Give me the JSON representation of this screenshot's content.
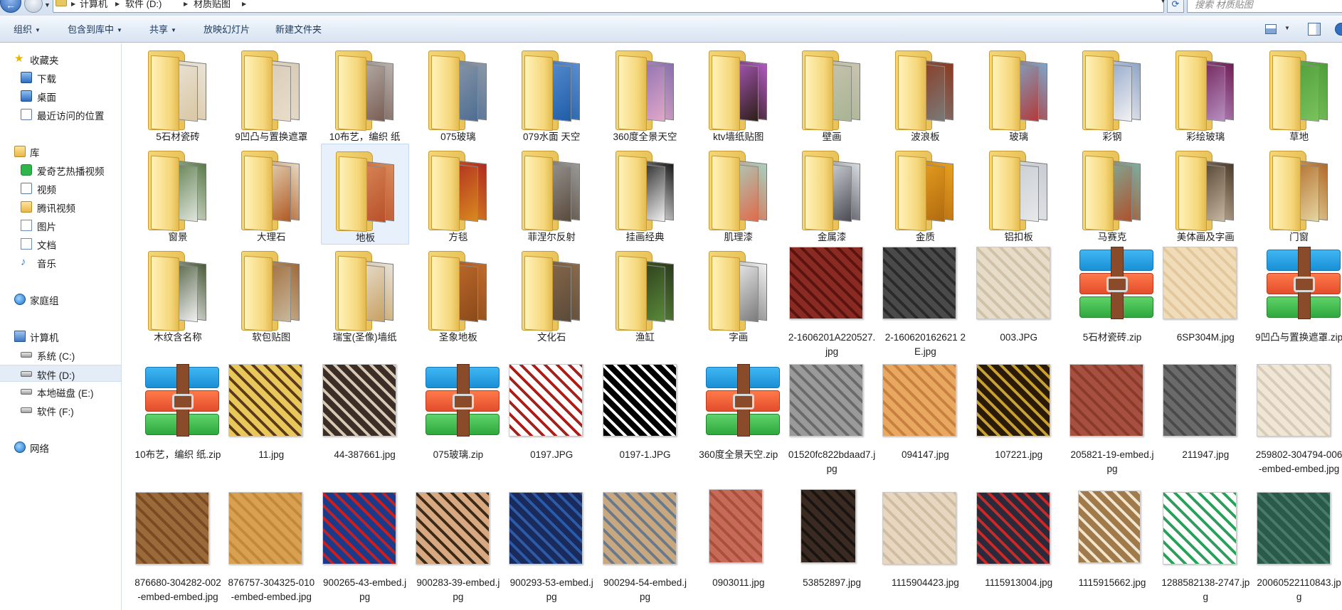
{
  "address_bar": {
    "breadcrumbs": [
      "计算机",
      "软件 (D:)",
      "材质贴图"
    ],
    "search_placeholder": "搜索 材质贴图"
  },
  "toolbar": {
    "organize": "组织",
    "include_in_library": "包含到库中",
    "share": "共享",
    "slideshow": "放映幻灯片",
    "new_folder": "新建文件夹"
  },
  "sidebar": {
    "favorites": "收藏夹",
    "downloads": "下载",
    "desktop": "桌面",
    "recent_places": "最近访问的位置",
    "libraries": "库",
    "iqiyi": "爱奇艺热播视频",
    "videos": "视频",
    "tencent_video": "腾讯视频",
    "pictures": "图片",
    "documents": "文档",
    "music": "音乐",
    "homegroup": "家庭组",
    "computer": "计算机",
    "drive_c": "系统 (C:)",
    "drive_d": "软件 (D:)",
    "drive_e": "本地磁盘 (E:)",
    "drive_f": "软件 (F:)",
    "network": "网络"
  },
  "items": [
    {
      "name": "5石材瓷砖",
      "type": "folder",
      "colors": [
        "#e9e3d6",
        "#d9c7a4"
      ]
    },
    {
      "name": "9凹凸与置换遮罩",
      "type": "folder",
      "colors": [
        "#d8ccb8",
        "#e8ddc8"
      ]
    },
    {
      "name": "10布艺，编织 纸",
      "type": "folder",
      "colors": [
        "#b9b2ad",
        "#7a5d52"
      ]
    },
    {
      "name": "075玻璃",
      "type": "folder",
      "colors": [
        "#8b98a8",
        "#4e6d92"
      ]
    },
    {
      "name": "079水面 天空",
      "type": "folder",
      "colors": [
        "#5a8fd0",
        "#1f5da8"
      ]
    },
    {
      "name": "360度全景天空",
      "type": "folder",
      "colors": [
        "#8a6fb0",
        "#e1a7c9"
      ]
    },
    {
      "name": "ktv墙纸贴图",
      "type": "folder",
      "colors": [
        "#b05ac0",
        "#2b1e16"
      ]
    },
    {
      "name": "壁画",
      "type": "folder",
      "colors": [
        "#c9c3b0",
        "#a7b592"
      ]
    },
    {
      "name": "波浪板",
      "type": "folder",
      "colors": [
        "#8a3a20",
        "#7a7a7a"
      ]
    },
    {
      "name": "玻璃",
      "type": "folder",
      "colors": [
        "#7fa6c7",
        "#b23a3a"
      ]
    },
    {
      "name": "彩钢",
      "type": "folder",
      "colors": [
        "#8ea4c8",
        "#f2f2f2"
      ]
    },
    {
      "name": "彩绘玻璃",
      "type": "folder",
      "colors": [
        "#6e1f55",
        "#b78fc2"
      ]
    },
    {
      "name": "草地",
      "type": "folder",
      "colors": [
        "#4e9e3a",
        "#7ac25c"
      ]
    },
    {
      "name": "窗景",
      "type": "folder",
      "colors": [
        "#5a7a4a",
        "#e0e6dc"
      ]
    },
    {
      "name": "大理石",
      "type": "folder",
      "colors": [
        "#e6d8c0",
        "#b05a22"
      ]
    },
    {
      "name": "地板",
      "type": "folder",
      "colors": [
        "#d98a5a",
        "#b8502a"
      ]
    },
    {
      "name": "方毯",
      "type": "folder",
      "colors": [
        "#b02a20",
        "#d88a20"
      ]
    },
    {
      "name": "菲涅尔反射",
      "type": "folder",
      "colors": [
        "#9a9a9a",
        "#5a4a3a"
      ]
    },
    {
      "name": "挂画经典",
      "type": "folder",
      "colors": [
        "#1a1a1a",
        "#f2f2f2"
      ]
    },
    {
      "name": "肌理漆",
      "type": "folder",
      "colors": [
        "#a8d0c0",
        "#e06a4a"
      ]
    },
    {
      "name": "金属漆",
      "type": "folder",
      "colors": [
        "#d8dde2",
        "#4a4a52"
      ]
    },
    {
      "name": "金质",
      "type": "folder",
      "colors": [
        "#e8a020",
        "#b06a10"
      ]
    },
    {
      "name": "铝扣板",
      "type": "folder",
      "colors": [
        "#c8ccd2",
        "#e6e8ea"
      ]
    },
    {
      "name": "马赛克",
      "type": "folder",
      "colors": [
        "#7ab0a0",
        "#b0502a"
      ]
    },
    {
      "name": "美体画及字画",
      "type": "folder",
      "colors": [
        "#4a3a2a",
        "#c8b8a0"
      ]
    },
    {
      "name": "门窗",
      "type": "folder",
      "colors": [
        "#b06a2a",
        "#e6d6a0"
      ]
    },
    {
      "name": "木纹含名称",
      "type": "folder",
      "colors": [
        "#4a5a3a",
        "#f2f2f2"
      ]
    },
    {
      "name": "软包贴图",
      "type": "folder",
      "colors": [
        "#a06a3a",
        "#c8b89a"
      ]
    },
    {
      "name": "瑞宝(圣像)墙纸",
      "type": "folder",
      "colors": [
        "#e8e2d6",
        "#c8a060"
      ]
    },
    {
      "name": "圣象地板",
      "type": "folder",
      "colors": [
        "#c06a2a",
        "#8a4a1a"
      ]
    },
    {
      "name": "文化石",
      "type": "folder",
      "colors": [
        "#8a6a4a",
        "#5a4a3a"
      ]
    },
    {
      "name": "渔缸",
      "type": "folder",
      "colors": [
        "#2a3a1a",
        "#5a8a3a"
      ]
    },
    {
      "name": "字画",
      "type": "folder",
      "colors": [
        "#f2f2f2",
        "#7a7a7a"
      ]
    },
    {
      "name": "2-1606201A220527.jpg",
      "type": "image",
      "colors": [
        "#8a2a22",
        "#5a1410"
      ]
    },
    {
      "name": "2-160620162621 2E.jpg",
      "type": "image",
      "colors": [
        "#4a4a4a",
        "#2a2a2a"
      ]
    },
    {
      "name": "003.JPG",
      "type": "image",
      "colors": [
        "#e6dcc8",
        "#d0c2a8"
      ]
    },
    {
      "name": "5石材瓷砖.zip",
      "type": "archive",
      "colors": []
    },
    {
      "name": "6SP304M.jpg",
      "type": "image",
      "colors": [
        "#f0dcb8",
        "#e2c89c"
      ]
    },
    {
      "name": "9凹凸与置换遮罩.zip",
      "type": "archive",
      "colors": []
    },
    {
      "name": "10布艺，编织 纸.zip",
      "type": "archive",
      "colors": []
    },
    {
      "name": "11.jpg",
      "type": "image",
      "colors": [
        "#e8c85a",
        "#5a3a1a"
      ]
    },
    {
      "name": "44-387661.jpg",
      "type": "image",
      "colors": [
        "#3a2e26",
        "#d6c8b2"
      ]
    },
    {
      "name": "075玻璃.zip",
      "type": "archive",
      "colors": []
    },
    {
      "name": "0197.JPG",
      "type": "image",
      "colors": [
        "#ffffff",
        "#a8201a"
      ]
    },
    {
      "name": "0197-1.JPG",
      "type": "image",
      "colors": [
        "#000000",
        "#ffffff"
      ]
    },
    {
      "name": "360度全景天空.zip",
      "type": "archive",
      "colors": []
    },
    {
      "name": "01520fc822bdaad7.jpg",
      "type": "image",
      "colors": [
        "#9a9a9a",
        "#6a6a6a"
      ]
    },
    {
      "name": "094147.jpg",
      "type": "image",
      "colors": [
        "#e8a860",
        "#c88040"
      ]
    },
    {
      "name": "107221.jpg",
      "type": "image",
      "colors": [
        "#2a1a0a",
        "#c8a030"
      ]
    },
    {
      "name": "205821-19-embed.jpg",
      "type": "image",
      "colors": [
        "#a85040",
        "#8a3a2a"
      ]
    },
    {
      "name": "211947.jpg",
      "type": "image",
      "colors": [
        "#6a6a6a",
        "#4a4a4a"
      ]
    },
    {
      "name": "259802-304794-006-embed-embed.jpg",
      "type": "image",
      "colors": [
        "#f0e6d6",
        "#d8ccb8"
      ]
    },
    {
      "name": "876680-304282-002-embed-embed.jpg",
      "type": "image",
      "colors": [
        "#9a6a3a",
        "#7a4a22"
      ]
    },
    {
      "name": "876757-304325-010-embed-embed.jpg",
      "type": "image",
      "colors": [
        "#d8a050",
        "#c08a3a"
      ]
    },
    {
      "name": "900265-43-embed.jpg",
      "type": "image",
      "colors": [
        "#1a3a8a",
        "#c82020"
      ]
    },
    {
      "name": "900283-39-embed.jpg",
      "type": "image",
      "colors": [
        "#d8a880",
        "#3a2a1a"
      ]
    },
    {
      "name": "900293-53-embed.jpg",
      "type": "image",
      "colors": [
        "#1a2a5a",
        "#2a5aa8"
      ]
    },
    {
      "name": "900294-54-embed.jpg",
      "type": "image",
      "colors": [
        "#c8a880",
        "#6a7a8a"
      ]
    },
    {
      "name": "0903011.jpg",
      "type": "image",
      "colors": [
        "#c86a5a",
        "#a8503a"
      ]
    },
    {
      "name": "53852897.jpg",
      "type": "image",
      "colors": [
        "#3a2a22",
        "#1a1410"
      ]
    },
    {
      "name": "1115904423.jpg",
      "type": "image",
      "colors": [
        "#e8d6c0",
        "#d0bca0"
      ]
    },
    {
      "name": "1115913004.jpg",
      "type": "image",
      "colors": [
        "#2a2a3a",
        "#c82a2a"
      ]
    },
    {
      "name": "1115915662.jpg",
      "type": "image",
      "colors": [
        "#a07a4a",
        "#f0e6d0"
      ]
    },
    {
      "name": "1288582138-2747.jpg",
      "type": "image",
      "colors": [
        "#ffffff",
        "#2aa05a"
      ]
    },
    {
      "name": "20060522110843.jpg",
      "type": "image",
      "colors": [
        "#2a5a4a",
        "#4a7a6a"
      ]
    }
  ]
}
